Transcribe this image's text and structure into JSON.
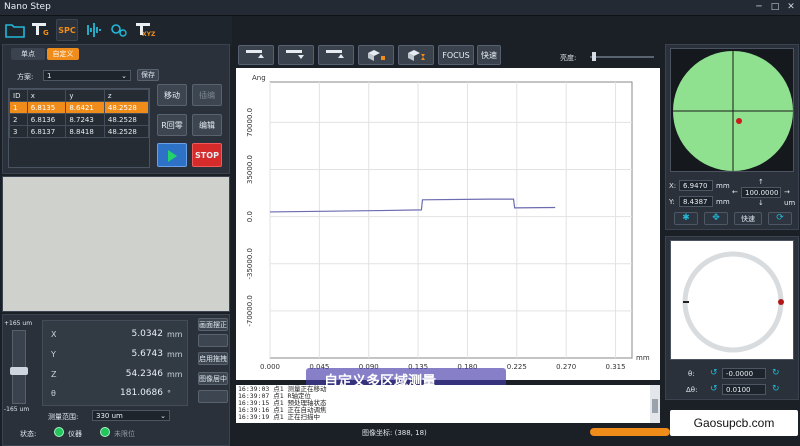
{
  "app": {
    "title": "Nano Step"
  },
  "toolbar": {
    "spc_label": "SPC",
    "g_label": "G",
    "xyz_label": "XYZ"
  },
  "tabs": {
    "single_point": "单点",
    "custom": "自定义"
  },
  "plan": {
    "label": "方案:",
    "value": "1",
    "save": "保存"
  },
  "table": {
    "headers": [
      "ID",
      "x",
      "y",
      "z"
    ],
    "rows": [
      [
        "1",
        "6.8135",
        "8.6421",
        "48.2528"
      ],
      [
        "2",
        "6.8136",
        "8.7243",
        "48.2528"
      ],
      [
        "3",
        "6.8137",
        "8.8418",
        "48.2528"
      ]
    ]
  },
  "actions": {
    "move": "移动",
    "insert": "插编",
    "r_zero": "R回零",
    "edit": "编辑",
    "stop": "STOP"
  },
  "readout": {
    "x_label": "X",
    "x_value": "5.0342",
    "x_unit": "mm",
    "y_label": "Y",
    "y_value": "5.6743",
    "y_unit": "mm",
    "z_label": "Z",
    "z_value": "54.2346",
    "z_unit": "mm",
    "t_label": "θ",
    "t_value": "181.0686",
    "t_unit": "°"
  },
  "side_buttons": {
    "flatten": "画面摆正",
    "enable_drag": "启用拖拽",
    "center_image": "图像居中"
  },
  "range": {
    "top": "+165 um",
    "bottom": "-165 um",
    "label": "测量范围:",
    "value": "330 um"
  },
  "status": {
    "label": "状态:",
    "instrument": "仪器",
    "unlimited": "未限位",
    "instrument_color": "#22c55e",
    "unlimited_color": "#22c55e"
  },
  "chart_controls": {
    "focus": "FOCUS",
    "fast": "快速",
    "brightness": "亮度:"
  },
  "chart_data": {
    "type": "line",
    "ylabel": "Ang",
    "xlabel": "mm",
    "xlim": [
      0.0,
      0.33
    ],
    "ylim": [
      -105000,
      100000
    ],
    "x_ticks": [
      "0.000",
      "0.045",
      "0.090",
      "0.135",
      "0.180",
      "0.225",
      "0.270",
      "0.315"
    ],
    "y_ticks": [
      "70000.0",
      "35000.0",
      "0.0",
      "-35000.0",
      "-70000.0"
    ],
    "series": [
      {
        "color": "#6b6bb0",
        "points": [
          [
            0.0,
            3500
          ],
          [
            0.1,
            4500
          ],
          [
            0.138,
            5000
          ],
          [
            0.139,
            12500
          ],
          [
            0.2,
            13000
          ],
          [
            0.222,
            13000
          ],
          [
            0.223,
            6500
          ],
          [
            0.26,
            6800
          ]
        ]
      }
    ]
  },
  "caption": "自定义多区域测量",
  "log": {
    "lines": [
      "16:39:03 点1 测量正在移动",
      "16:39:07 点1 R轴定位",
      "16:39:15 点1 预处理轴状态",
      "16:39:16 点1 正在自动调焦",
      "16:39:19 点1 正在扫描中"
    ]
  },
  "image_coords": "图像坐标: (388, 18)",
  "xy_panel": {
    "x_label": "X:",
    "x_value": "6.9470",
    "x_unit": "mm",
    "y_label": "Y:",
    "y_value": "8.4387",
    "y_unit": "mm",
    "step": "100.0000",
    "step_unit": "um",
    "fast": "快速",
    "circle_color": "#8fe08f"
  },
  "rotate_panel": {
    "theta_label": "θ:",
    "theta_value": "-0.0000",
    "dtheta_label": "Δθ:",
    "dtheta_value": "0.0100"
  },
  "watermark": "Gaosupcb.com"
}
